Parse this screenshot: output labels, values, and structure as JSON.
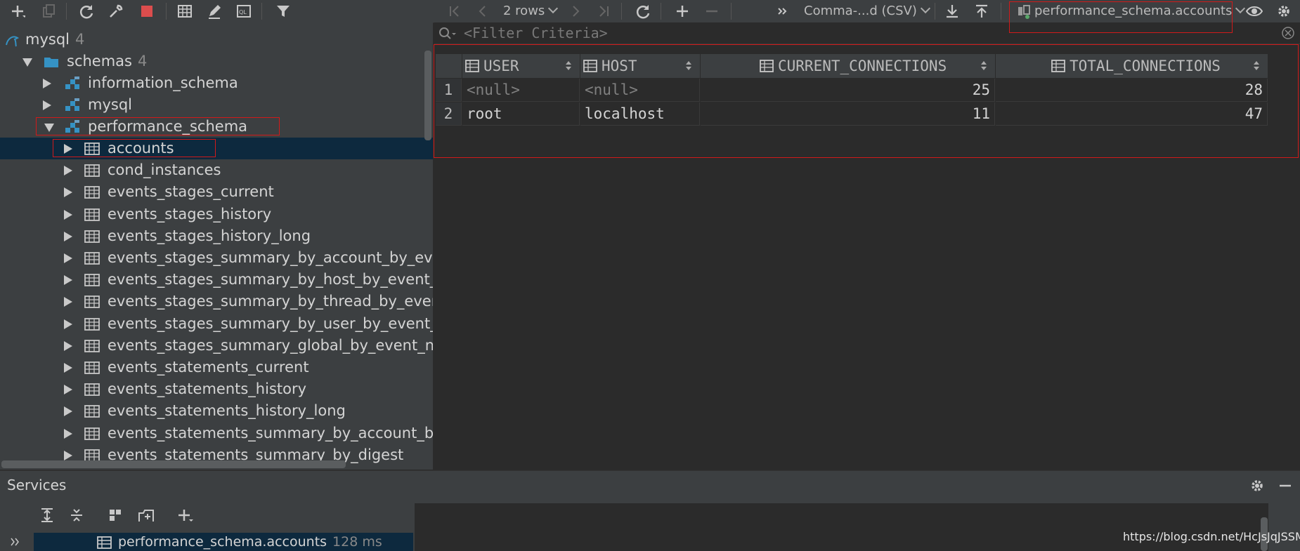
{
  "toolbar": {
    "rows_label": "2 rows",
    "export_format": "Comma-...d (CSV)",
    "context": "performance_schema.accounts",
    "icons": [
      "plus-icon",
      "duplicate-icon",
      "refresh-icon",
      "settings-wrench-icon",
      "stop-icon",
      "table-view-icon",
      "edit-icon",
      "ql-icon",
      "filter-icon",
      "first-page-icon",
      "prev-page-icon",
      "next-page-icon",
      "last-page-icon",
      "reload-icon",
      "add-row-icon",
      "delete-row-icon",
      "more-icon",
      "download-icon",
      "upload-icon",
      "datasource-icon",
      "eye-icon",
      "gear-icon"
    ]
  },
  "tree": {
    "root": {
      "label": "mysql",
      "count": "4"
    },
    "schemas": {
      "label": "schemas",
      "count": "4"
    },
    "databases": [
      "information_schema",
      "mysql",
      "performance_schema"
    ],
    "tables": [
      "accounts",
      "cond_instances",
      "events_stages_current",
      "events_stages_history",
      "events_stages_history_long",
      "events_stages_summary_by_account_by_event_na",
      "events_stages_summary_by_host_by_event_name",
      "events_stages_summary_by_thread_by_event_nar",
      "events_stages_summary_by_user_by_event_name",
      "events_stages_summary_global_by_event_name",
      "events_statements_current",
      "events_statements_history",
      "events_statements_history_long",
      "events_statements_summary_by_account_by_eve",
      "events_statements_summary_by_digest"
    ]
  },
  "grid": {
    "filter_placeholder": "<Filter Criteria>",
    "columns": [
      "USER",
      "HOST",
      "CURRENT_CONNECTIONS",
      "TOTAL_CONNECTIONS"
    ],
    "rows": [
      {
        "n": "1",
        "user": "<null>",
        "host": "<null>",
        "current": "25",
        "total": "28"
      },
      {
        "n": "2",
        "user": "root",
        "host": "localhost",
        "current": "11",
        "total": "47"
      }
    ]
  },
  "services": {
    "title": "Services",
    "node_label": "performance_schema.accounts",
    "node_time": "128 ms",
    "watermark": "https://blog.csdn.net/HcJsJqJSSM"
  },
  "colors": {
    "highlight": "#d11a1a",
    "selection": "#0d293e",
    "accent": "#3592c4"
  }
}
